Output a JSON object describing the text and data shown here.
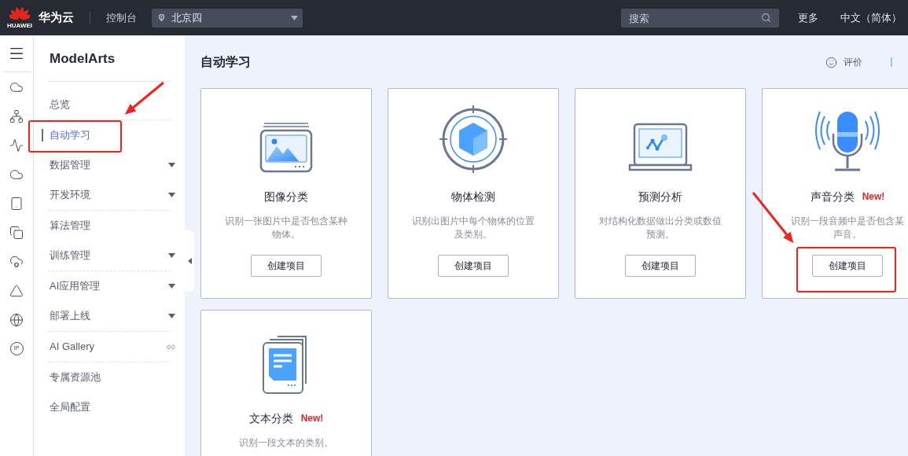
{
  "topbar": {
    "logo_text": "HUAWEI",
    "brand": "华为云",
    "console": "控制台",
    "region": "北京四",
    "search": {
      "placeholder": "搜索"
    },
    "links": [
      "更多",
      "中文（简体）"
    ]
  },
  "rail": {
    "badge": "IP"
  },
  "sidebar": {
    "title": "ModelArts",
    "groups": [
      [
        {
          "label": "总览",
          "kind": "plain",
          "selected": false
        }
      ],
      [
        {
          "label": "自动学习",
          "kind": "plain",
          "selected": true
        },
        {
          "label": "数据管理",
          "kind": "expandable",
          "selected": false
        },
        {
          "label": "开发环境",
          "kind": "expandable",
          "selected": false
        }
      ],
      [
        {
          "label": "算法管理",
          "kind": "plain",
          "selected": false
        },
        {
          "label": "训练管理",
          "kind": "expandable",
          "selected": false
        }
      ],
      [
        {
          "label": "AI应用管理",
          "kind": "expandable",
          "selected": false
        },
        {
          "label": "部署上线",
          "kind": "expandable",
          "selected": false
        }
      ],
      [
        {
          "label": "AI Gallery",
          "kind": "link",
          "selected": false
        }
      ],
      [
        {
          "label": "专属资源池",
          "kind": "plain",
          "selected": false
        },
        {
          "label": "全局配置",
          "kind": "plain",
          "selected": false
        }
      ]
    ]
  },
  "main": {
    "title": "自动学习",
    "feedback": "评价",
    "cards": [
      {
        "kind": "image",
        "title": "图像分类",
        "description": [
          "识别一张图片中是否包含某种",
          "物体。"
        ],
        "button": "创建项目"
      },
      {
        "kind": "object",
        "title": "物体检测",
        "description": [
          "识别出图片中每个物体的位置",
          "及类别。"
        ],
        "button": "创建项目"
      },
      {
        "kind": "chart",
        "title": "预测分析",
        "description": [
          "对结构化数据做出分类或数值",
          "预测。"
        ],
        "button": "创建项目"
      },
      {
        "kind": "audio",
        "title": "声音分类",
        "badge": "New!",
        "description": [
          "识别一段音频中是否包含某",
          "声音。"
        ],
        "button": "创建项目"
      },
      {
        "kind": "text",
        "title": "文本分类",
        "badge": "New!",
        "description": [
          "识别一段文本的类别。"
        ]
      }
    ]
  }
}
